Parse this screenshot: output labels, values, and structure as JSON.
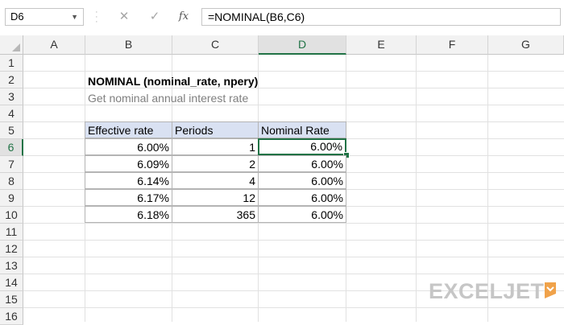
{
  "formula_bar": {
    "name_box": "D6",
    "cancel_icon": "✕",
    "enter_icon": "✓",
    "fx_label": "fx",
    "formula": "=NOMINAL(B6,C6)"
  },
  "grid": {
    "columns": [
      "A",
      "B",
      "C",
      "D",
      "E",
      "F",
      "G"
    ],
    "rows": [
      "1",
      "2",
      "3",
      "4",
      "5",
      "6",
      "7",
      "8",
      "9",
      "10",
      "11",
      "12",
      "13",
      "14",
      "15",
      "16"
    ],
    "active_cell": "D6"
  },
  "sheet": {
    "title": "NOMINAL (nominal_rate, npery)",
    "subtitle": "Get nominal annual interest rate",
    "table": {
      "headers": [
        "Effective rate",
        "Periods",
        "Nominal Rate"
      ],
      "rows": [
        [
          "6.00%",
          "1",
          "6.00%"
        ],
        [
          "6.09%",
          "2",
          "6.00%"
        ],
        [
          "6.14%",
          "4",
          "6.00%"
        ],
        [
          "6.17%",
          "12",
          "6.00%"
        ],
        [
          "6.18%",
          "365",
          "6.00%"
        ]
      ]
    }
  },
  "watermark": {
    "text": "EXCELJET"
  },
  "colors": {
    "accent": "#217346",
    "header_fill": "#d9e1f2",
    "logo_orange": "#f0a24a"
  }
}
